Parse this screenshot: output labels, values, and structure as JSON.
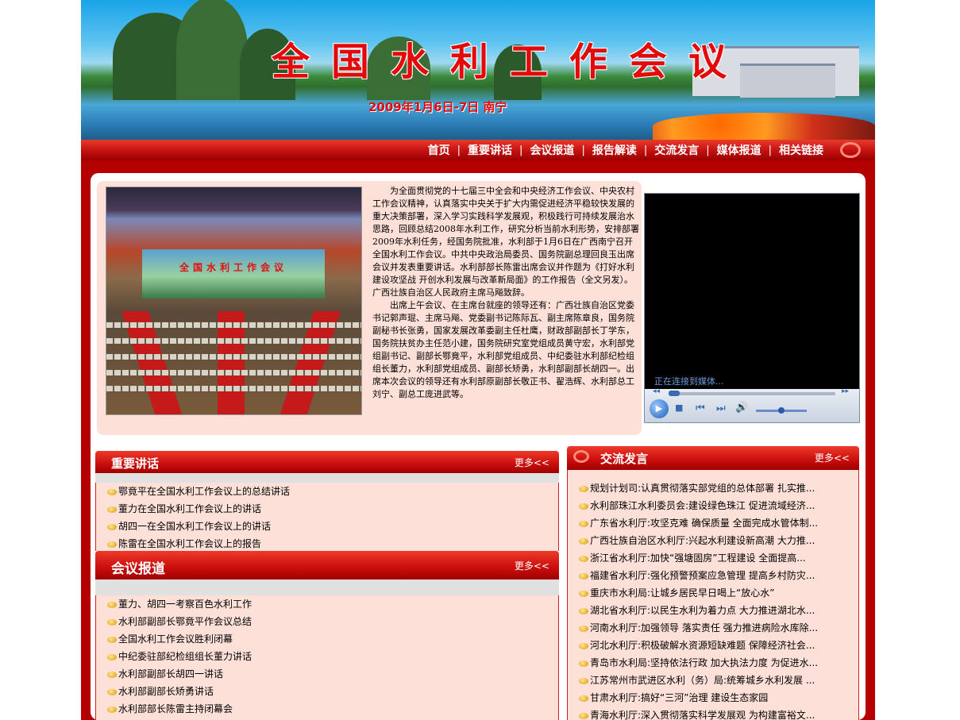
{
  "banner": {
    "title": "全国水利工作会议",
    "subtitle": "2009年1月6日-7日  南宁"
  },
  "nav": {
    "items": [
      "首页",
      "重要讲话",
      "会议报道",
      "报告解读",
      "交流发言",
      "媒体报道",
      "相关链接"
    ],
    "separator": "|"
  },
  "intro": {
    "photo_screen_text": "全国水利工作会议",
    "paragraphs": [
      "为全面贯彻党的十七届三中全会和中央经济工作会议、中央农村工作会议精神，认真落实中央关于扩大内需促进经济平稳较快发展的重大决策部署，深入学习实践科学发展观，积极践行可持续发展治水思路，回顾总结2008年水利工作，研究分析当前水利形势，安排部署2009年水利任务，经国务院批准，水利部于1月6日在广西南宁召开全国水利工作会议。中共中央政治局委员、国务院副总理回良玉出席会议并发表重要讲话。水利部部长陈雷出席会议并作题为《打好水利建设攻坚战 开创水利发展与改革新局面》的工作报告（全文另发）。广西壮族自治区人民政府主席马飚致辞。",
      "出席上午会议、在主席台就座的领导还有：广西壮族自治区党委书记郭声琨、主席马飚、党委副书记陈际瓦、副主席陈章良，国务院副秘书长张勇，国家发展改革委副主任杜鹰，财政部副部长丁学东，国务院扶贫办主任范小建，国务院研究室党组成员黄守宏，水利部党组副书记、副部长鄂竟平，水利部党组成员、中纪委驻水利部纪检组组长董力，水利部党组成员、副部长矫勇，水利部副部长胡四一。出席本次会议的领导还有水利部原副部长敬正书、翟浩辉、水利部总工刘宁、副总工庞进武等。"
    ]
  },
  "player": {
    "status": "正在连接到媒体..."
  },
  "speeches": {
    "title": "重要讲话",
    "more": "更多<<",
    "items": [
      "鄂竟平在全国水利工作会议上的总结讲话",
      "董力在全国水利工作会议上的讲话",
      "胡四一在全国水利工作会议上的讲话",
      "陈雷在全国水利工作会议上的报告"
    ]
  },
  "reports": {
    "title": "会议报道",
    "more": "更多<<",
    "items": [
      "董力、胡四一考察百色水利工作",
      "水利部副部长鄂竟平作会议总结",
      "全国水利工作会议胜利闭幕",
      "中纪委驻部纪检组组长董力讲话",
      "水利部副部长胡四一讲话",
      "水利部副部长矫勇讲话",
      "水利部部长陈雷主持闭幕会"
    ]
  },
  "exchange": {
    "title": "交流发言",
    "more": "更多<<",
    "items": [
      "规划计划司:认真贯彻落实部党组的总体部署 扎实推...",
      "水利部珠江水利委员会:建设绿色珠江 促进流域经济...",
      "广东省水利厅:攻坚克难 确保质量 全面完成水管体制...",
      "广西壮族自治区水利厅:兴起水利建设新高潮 大力推...",
      "浙江省水利厅:加快“强塘固房”工程建设   全面提高...",
      "福建省水利厅:强化预警预案应急管理 提高乡村防灾...",
      "重庆市水利局:让城乡居民早日喝上“放心水”",
      "湖北省水利厅:以民生水利为着力点 大力推进湖北水...",
      "河南水利厅:加强领导 落实责任 强力推进病险水库除...",
      "河北水利厅:积极破解水资源短缺难题 保障经济社会...",
      "青岛市水利局:坚持依法行政 加大执法力度 为促进水...",
      "江苏常州市武进区水利（务）局:统筹城乡水利发展 ...",
      "甘肃水利厅:搞好“三河”治理 建设生态家园",
      "青海水利厅:深入贯彻落实科学发展观 为构建富裕文..."
    ]
  },
  "colors": {
    "primary_red": "#c80d0d",
    "panel_bg": "#fde0d8",
    "title_red": "#e20a0a"
  }
}
